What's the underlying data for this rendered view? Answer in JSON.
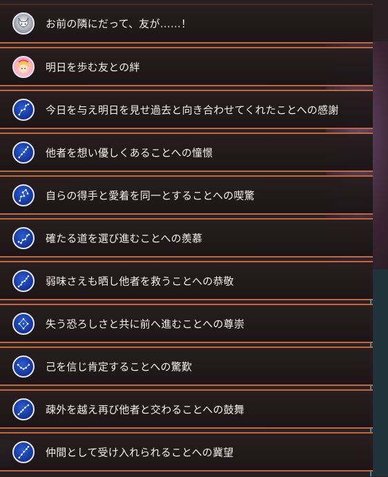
{
  "achievements": [
    {
      "icon": "wolf-avatar-icon",
      "label": "お前の隣にだって、友が……！"
    },
    {
      "icon": "girl-avatar-icon",
      "label": "明日を歩む友との絆"
    },
    {
      "icon": "constellation-icon",
      "label": "今日を与え明日を見せ過去と向き合わせてくれたことへの感謝"
    },
    {
      "icon": "constellation-icon",
      "label": "他者を想い優しくあることへの憧憬"
    },
    {
      "icon": "constellation-icon",
      "label": "自らの得手と愛着を同一とすることへの喫驚"
    },
    {
      "icon": "constellation-icon",
      "label": "確たる道を選び進むことへの羨慕"
    },
    {
      "icon": "constellation-icon",
      "label": "弱味さえも晒し他者を救うことへの恭敬"
    },
    {
      "icon": "constellation-icon",
      "label": "失う恐ろしさと共に前へ進むことへの尊崇"
    },
    {
      "icon": "constellation-icon",
      "label": "己を信じ肯定することへの驚歎"
    },
    {
      "icon": "constellation-icon",
      "label": "疎外を越え再び他者と交わることへの鼓舞"
    },
    {
      "icon": "constellation-icon",
      "label": "仲間として受け入れられることへの冀望"
    }
  ],
  "colors": {
    "row_border": "#c06a3c",
    "text": "#f4efe9",
    "constellation_bg": "#1738a0"
  }
}
